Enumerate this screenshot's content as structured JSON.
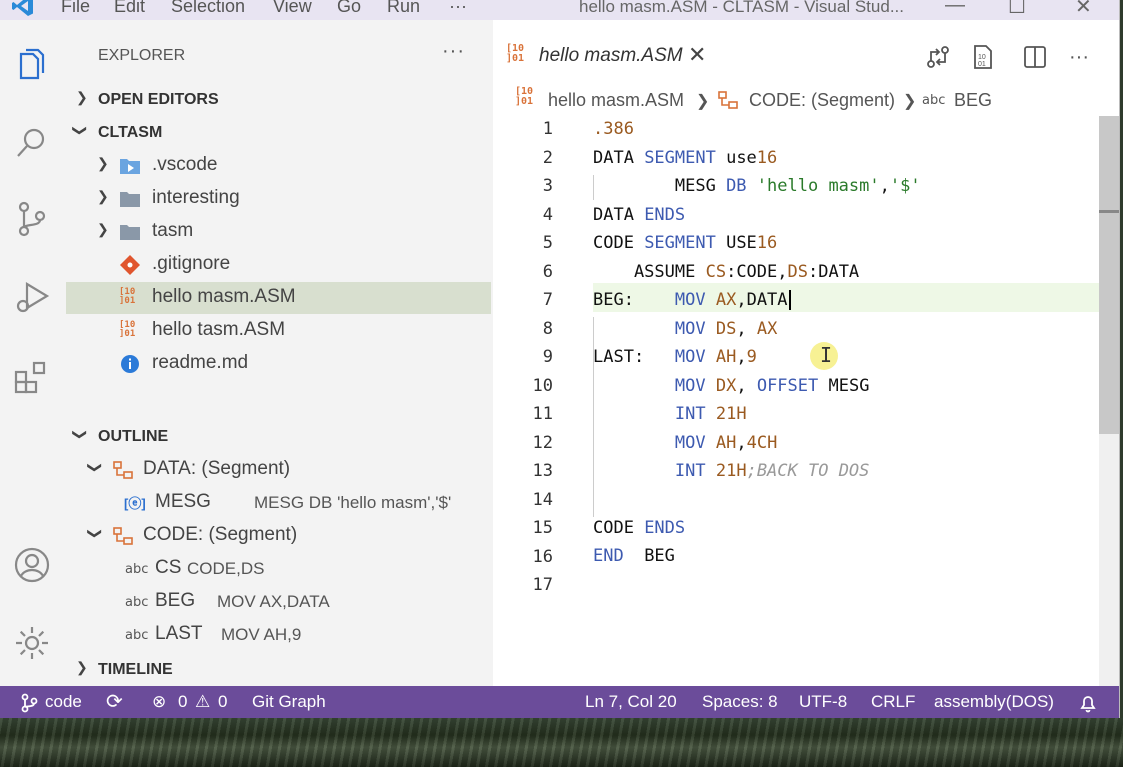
{
  "titlebar": {
    "menu": [
      "File",
      "Edit",
      "Selection",
      "View",
      "Go",
      "Run",
      "···"
    ],
    "title": "hello masm.ASM - CLTASM - Visual Stud..."
  },
  "activity": [
    "explorer-icon",
    "search-icon",
    "source-control-icon",
    "run-debug-icon",
    "extensions-icon",
    "accounts-icon",
    "settings-gear-icon"
  ],
  "sidebar": {
    "header": "EXPLORER",
    "more": "···",
    "open_editors": "OPEN EDITORS",
    "project": "CLTASM",
    "files": [
      ".vscode",
      "interesting",
      "tasm",
      ".gitignore",
      "hello masm.ASM",
      "hello tasm.ASM",
      "readme.md"
    ],
    "outline_header": "OUTLINE",
    "outline": {
      "data_seg": "DATA: (Segment)",
      "mesg_label": "MESG",
      "mesg_desc": "MESG DB 'hello masm','$'",
      "code_seg": "CODE: (Segment)",
      "cs_label": "CS",
      "cs_desc": "CODE,DS",
      "beg_label": "BEG",
      "beg_desc": "MOV AX,DATA",
      "last_label": "LAST",
      "last_desc": "MOV AH,9",
      "abc": "abc"
    },
    "timeline": "TIMELINE"
  },
  "editor": {
    "tab_title": "hello masm.ASM",
    "tab_icon": "10 01",
    "breadcrumb": {
      "file": "hello masm.ASM",
      "segment": "CODE: (Segment)",
      "abc": "abc",
      "symbol": "BEG"
    },
    "line_numbers": [
      "1",
      "2",
      "3",
      "4",
      "5",
      "6",
      "7",
      "8",
      "9",
      "10",
      "11",
      "12",
      "13",
      "14",
      "15",
      "16",
      "17"
    ],
    "current_line": 7
  },
  "statusbar": {
    "branch": "code",
    "errors": "0",
    "warnings": "0",
    "git_graph": "Git Graph",
    "position": "Ln 7, Col 20",
    "spaces": "Spaces: 8",
    "encoding": "UTF-8",
    "eol": "CRLF",
    "language": "assembly(DOS)"
  },
  "colors": {
    "statusbar": "#6b4c9a",
    "selection": "#d8dfcf",
    "accent": "#3d5ab0"
  }
}
